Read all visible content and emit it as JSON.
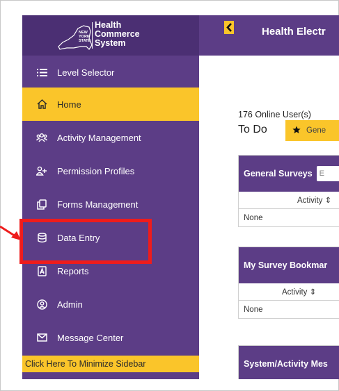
{
  "logo": {
    "line1": "Health",
    "line2": "Commerce",
    "line3": "System",
    "state_lines": [
      "NEW",
      "YORK",
      "STATE"
    ]
  },
  "sidebar": {
    "items": [
      {
        "label": "Level Selector",
        "icon": "list-icon"
      },
      {
        "label": "Home",
        "icon": "home-icon",
        "active": true
      },
      {
        "label": "Activity Management",
        "icon": "users-icon"
      },
      {
        "label": "Permission Profiles",
        "icon": "user-plus-icon"
      },
      {
        "label": "Forms Management",
        "icon": "copy-icon"
      },
      {
        "label": "Data Entry",
        "icon": "database-icon",
        "highlighted": true
      },
      {
        "label": "Reports",
        "icon": "file-pdf-icon"
      },
      {
        "label": "Admin",
        "icon": "user-circle-icon"
      },
      {
        "label": "Message Center",
        "icon": "envelope-icon"
      }
    ],
    "minimize_label": "Click Here To Minimize Sidebar"
  },
  "header": {
    "title": "Health Electr"
  },
  "main": {
    "online_users": "176 Online User(s)",
    "tabs": [
      {
        "label": "To Do"
      },
      {
        "label": "Gene"
      }
    ],
    "cards": [
      {
        "title": "General Surveys",
        "search_placeholder": "E",
        "column": "Activity ⇕",
        "row": "None"
      },
      {
        "title": "My Survey Bookmar",
        "column": "Activity ⇕",
        "row": "None"
      },
      {
        "title": "System/Activity Mes"
      }
    ]
  },
  "colors": {
    "brand_purple": "#5c3d86",
    "accent_yellow": "#fac52a",
    "highlight_red": "#ee1c1c"
  }
}
